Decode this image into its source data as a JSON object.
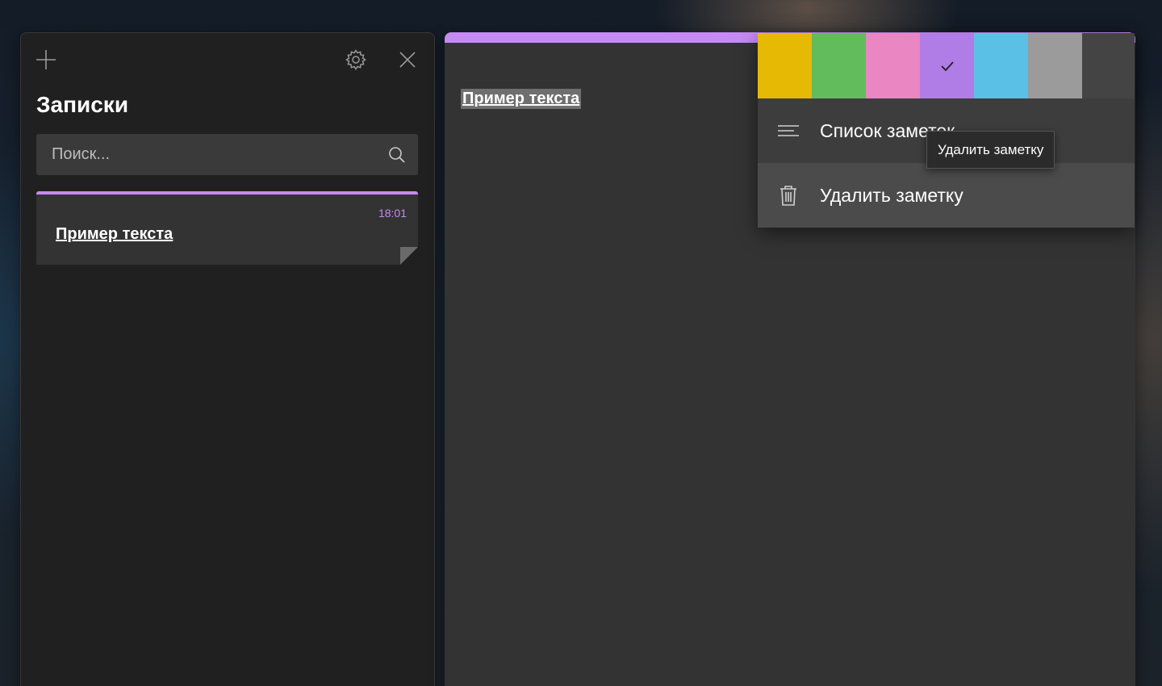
{
  "notes_list": {
    "title": "Записки",
    "search": {
      "placeholder": "Поиск...",
      "value": ""
    },
    "notes": [
      {
        "time": "18:01",
        "title": "Пример текста",
        "color": "#c58af3"
      }
    ],
    "icons": {
      "add": "plus-icon",
      "settings": "gear-icon",
      "close": "close-icon",
      "search": "search-icon"
    }
  },
  "editor": {
    "accent_color": "#c58af3",
    "text": "Пример текста"
  },
  "context_menu": {
    "colors": [
      {
        "name": "yellow",
        "hex": "#e6b905",
        "selected": false
      },
      {
        "name": "green",
        "hex": "#62bc5c",
        "selected": false
      },
      {
        "name": "pink",
        "hex": "#ea86c2",
        "selected": false
      },
      {
        "name": "purple",
        "hex": "#b07ce6",
        "selected": true
      },
      {
        "name": "blue",
        "hex": "#5ac0e6",
        "selected": false
      },
      {
        "name": "gray",
        "hex": "#9b9b9b",
        "selected": false
      }
    ],
    "items": [
      {
        "label": "Список заметок",
        "icon": "list-icon"
      },
      {
        "label": "Удалить заметку",
        "icon": "trash-icon"
      }
    ]
  },
  "tooltip": {
    "text": "Удалить заметку"
  }
}
